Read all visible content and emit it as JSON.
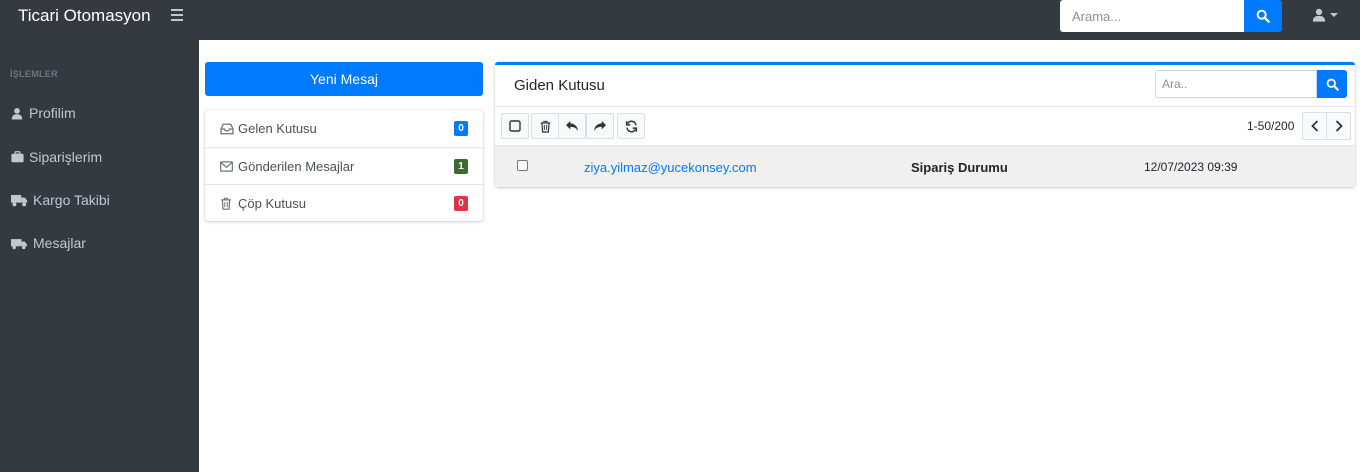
{
  "header": {
    "brand": "Ticari Otomasyon",
    "search_placeholder": "Arama..."
  },
  "sidebar": {
    "section_title": "İŞLEMLER",
    "items": [
      {
        "label": "Profilim",
        "icon": "user-icon"
      },
      {
        "label": "Siparişlerim",
        "icon": "briefcase-icon"
      },
      {
        "label": "Kargo Takibi",
        "icon": "truck-icon"
      },
      {
        "label": "Mesajlar",
        "icon": "mail-icon"
      }
    ]
  },
  "mailbox": {
    "new_message_label": "Yeni Mesaj",
    "folders": [
      {
        "label": "Gelen Kutusu",
        "count": "0",
        "icon": "inbox-icon",
        "badge_color": "#007bff"
      },
      {
        "label": "Gönderilen Mesajlar",
        "count": "1",
        "icon": "envelope-icon",
        "badge_color": "#3d6b2e"
      },
      {
        "label": "Çöp Kutusu",
        "count": "0",
        "icon": "trash-icon",
        "badge_color": "#dc3545"
      }
    ]
  },
  "list": {
    "title": "Giden Kutusu",
    "search_placeholder": "Ara..",
    "pagination": "1-50/200",
    "rows": [
      {
        "email": "ziya.yilmaz@yucekonsey.com",
        "subject": "Sipariş Durumu",
        "date": "12/07/2023 09:39"
      }
    ]
  },
  "colors": {
    "primary": "#007bff",
    "sidebar_bg": "#343a40"
  }
}
